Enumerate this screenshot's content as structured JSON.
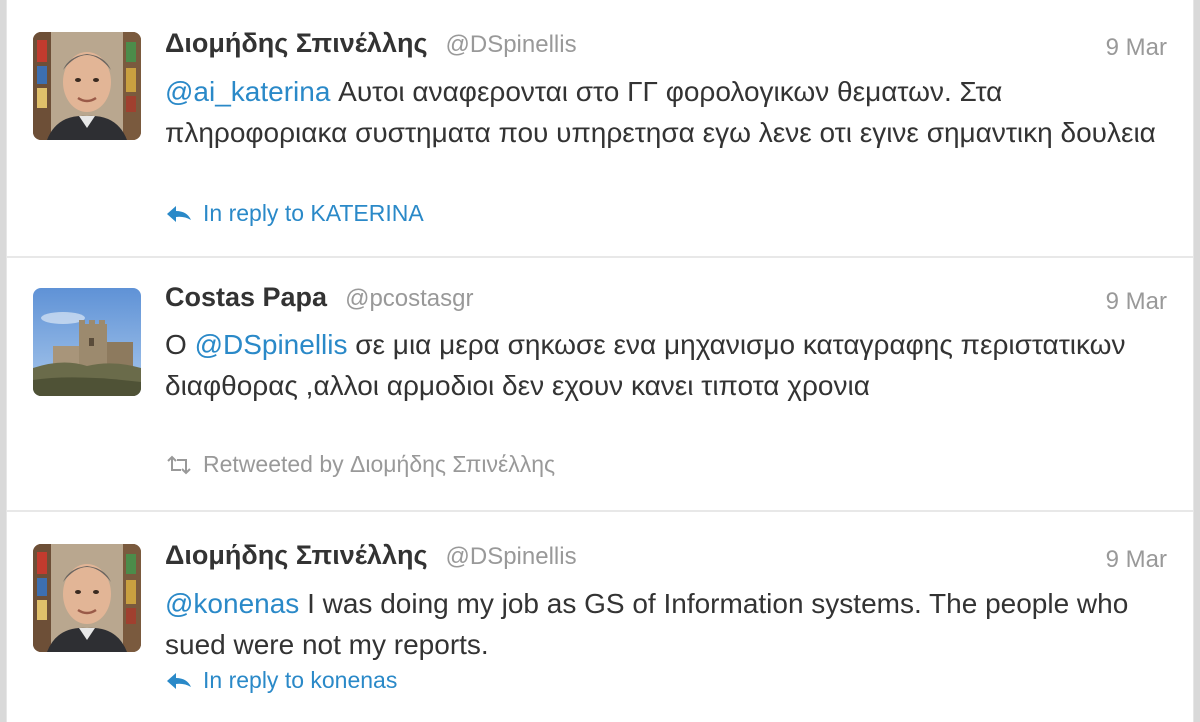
{
  "tweets": [
    {
      "author": "Διομήδης Σπινέλλης",
      "handle": "@DSpinellis",
      "date": "9 Mar",
      "mention": "@ai_katerina",
      "text_after": " Αυτοι αναφερονται στο ΓΓ φορολογικων θεματων. Στα πληροφοριακα συστηματα που υπηρετησα εγω λενε οτι εγινε σημαντικη δουλεια",
      "footer": "In reply to KATERINA",
      "footer_icon": "reply-arrow-icon",
      "avatar_icon": "user-avatar"
    },
    {
      "author": "Costas Papa",
      "handle": "@pcostasgr",
      "date": "9 Mar",
      "text_before": "Ο ",
      "mention": "@DSpinellis",
      "text_after": " σε μια μερα σηκωσε ενα μηχανισμο καταγραφης περιστατικων διαφθορας ,αλλοι αρμοδιοι δεν εχουν κανει τιποτα χρονια",
      "footer": "Retweeted by Διομήδης Σπινέλλης",
      "footer_icon": "retweet-icon",
      "avatar_icon": "castle-avatar"
    },
    {
      "author": "Διομήδης Σπινέλλης",
      "handle": "@DSpinellis",
      "date": "9 Mar",
      "mention": "@konenas",
      "text_after": " I was doing my job as GS of Information systems. The people who sued were not my reports.",
      "footer": "In reply to konenas",
      "footer_icon": "reply-arrow-icon",
      "avatar_icon": "user-avatar"
    }
  ],
  "colors": {
    "link": "#2a89c8",
    "muted": "#999999",
    "text": "#333333",
    "divider": "#e8e8e8"
  }
}
